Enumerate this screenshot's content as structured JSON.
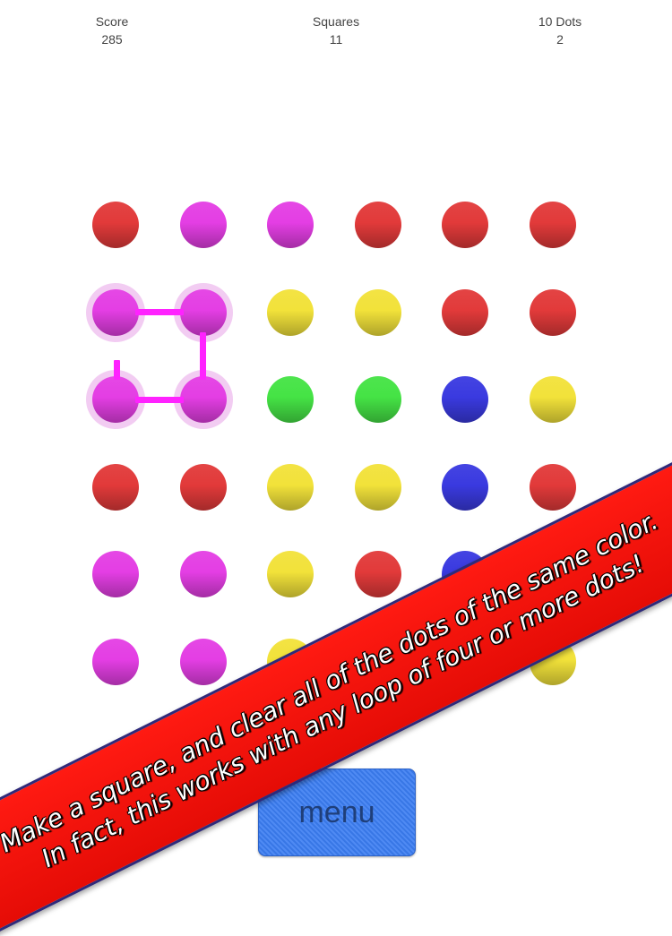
{
  "stats": {
    "score_label": "Score",
    "score_value": "285",
    "squares_label": "Squares",
    "squares_value": "11",
    "tendots_label": "10 Dots",
    "tendots_value": "2"
  },
  "colors": {
    "red": "#e23a3a",
    "magenta": "#e43ee4",
    "yellow": "#f2e23a",
    "green": "#45e345",
    "blue": "#3a3ae0",
    "link": "#ff22ff"
  },
  "board": {
    "rows": 6,
    "cols": 6,
    "grid": [
      [
        "red",
        "magenta",
        "magenta",
        "red",
        "red",
        "red"
      ],
      [
        "magenta",
        "magenta",
        "yellow",
        "yellow",
        "red",
        "red"
      ],
      [
        "magenta",
        "magenta",
        "green",
        "green",
        "blue",
        "yellow"
      ],
      [
        "red",
        "red",
        "yellow",
        "yellow",
        "blue",
        "red"
      ],
      [
        "magenta",
        "magenta",
        "yellow",
        "red",
        "blue",
        "yellow"
      ],
      [
        "magenta",
        "magenta",
        "yellow",
        "yellow",
        "green",
        "yellow"
      ]
    ],
    "selected_path": [
      [
        1,
        0
      ],
      [
        1,
        1
      ],
      [
        2,
        1
      ],
      [
        2,
        0
      ]
    ]
  },
  "menu": {
    "label": "menu"
  },
  "banner": {
    "line1": "Make a square, and clear all of the dots of the same color.",
    "line2": "In fact, this works with any loop of four or more dots!"
  }
}
